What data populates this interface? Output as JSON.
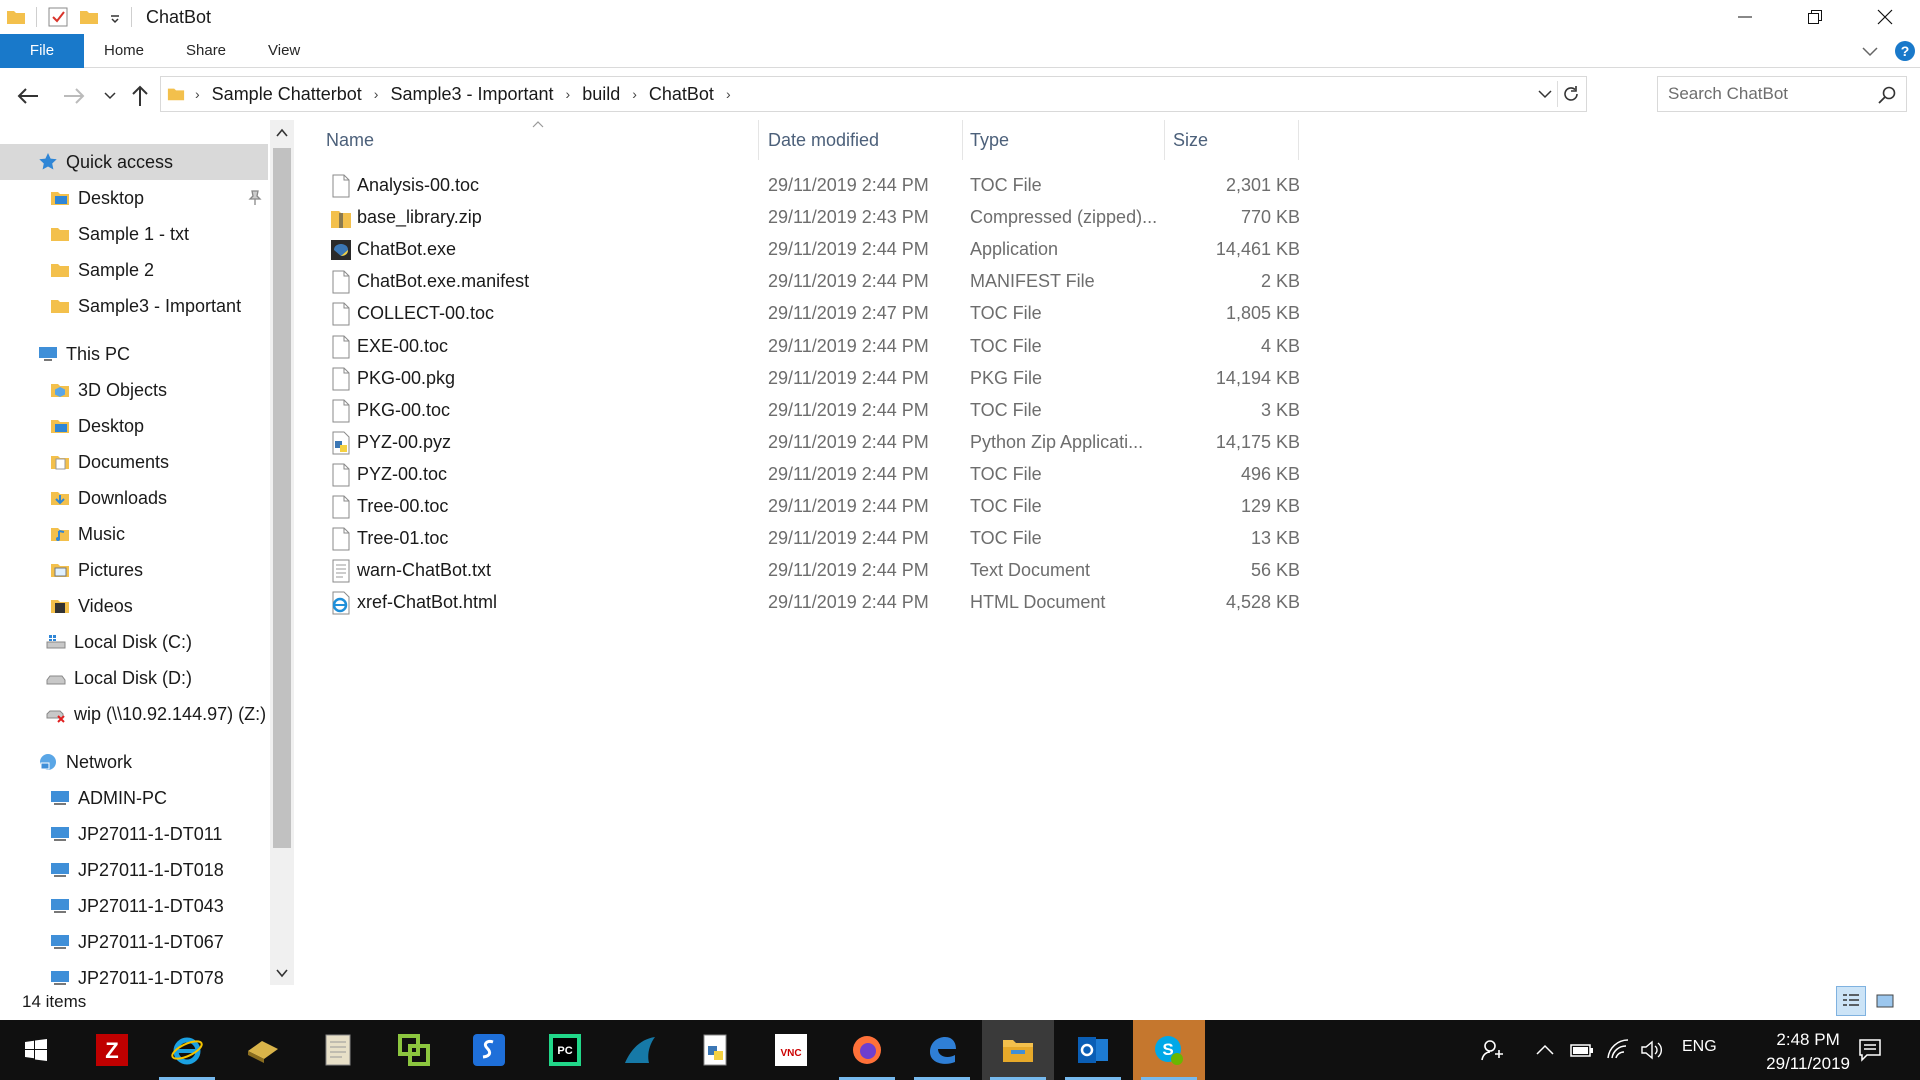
{
  "window": {
    "title": "ChatBot",
    "ribbon_tabs": [
      "File",
      "Home",
      "Share",
      "View"
    ]
  },
  "address": {
    "breadcrumbs": [
      "Sample Chatterbot",
      "Sample3 - Important",
      "build",
      "ChatBot"
    ]
  },
  "search": {
    "placeholder": "Search ChatBot"
  },
  "sidebar": {
    "quick_access": "Quick access",
    "quick_items": [
      "Desktop",
      "Sample 1 - txt",
      "Sample 2",
      "Sample3 - Important"
    ],
    "this_pc": "This PC",
    "pc_items": [
      "3D Objects",
      "Desktop",
      "Documents",
      "Downloads",
      "Music",
      "Pictures",
      "Videos",
      "Local Disk (C:)",
      "Local Disk (D:)",
      "wip (\\\\10.92.144.97) (Z:)"
    ],
    "network": "Network",
    "network_items": [
      "ADMIN-PC",
      "JP27011-1-DT011",
      "JP27011-1-DT018",
      "JP27011-1-DT043",
      "JP27011-1-DT067",
      "JP27011-1-DT078"
    ]
  },
  "columns": {
    "name": "Name",
    "date": "Date modified",
    "type": "Type",
    "size": "Size"
  },
  "files": [
    {
      "name": "Analysis-00.toc",
      "date": "29/11/2019 2:44 PM",
      "type": "TOC File",
      "size": "2,301 KB",
      "icon": "file-icon"
    },
    {
      "name": "base_library.zip",
      "date": "29/11/2019 2:43 PM",
      "type": "Compressed (zipped)...",
      "size": "770 KB",
      "icon": "zip-icon"
    },
    {
      "name": "ChatBot.exe",
      "date": "29/11/2019 2:44 PM",
      "type": "Application",
      "size": "14,461 KB",
      "icon": "exe-icon"
    },
    {
      "name": "ChatBot.exe.manifest",
      "date": "29/11/2019 2:44 PM",
      "type": "MANIFEST File",
      "size": "2 KB",
      "icon": "file-icon"
    },
    {
      "name": "COLLECT-00.toc",
      "date": "29/11/2019 2:47 PM",
      "type": "TOC File",
      "size": "1,805 KB",
      "icon": "file-icon"
    },
    {
      "name": "EXE-00.toc",
      "date": "29/11/2019 2:44 PM",
      "type": "TOC File",
      "size": "4 KB",
      "icon": "file-icon"
    },
    {
      "name": "PKG-00.pkg",
      "date": "29/11/2019 2:44 PM",
      "type": "PKG File",
      "size": "14,194 KB",
      "icon": "file-icon"
    },
    {
      "name": "PKG-00.toc",
      "date": "29/11/2019 2:44 PM",
      "type": "TOC File",
      "size": "3 KB",
      "icon": "file-icon"
    },
    {
      "name": "PYZ-00.pyz",
      "date": "29/11/2019 2:44 PM",
      "type": "Python Zip Applicati...",
      "size": "14,175 KB",
      "icon": "python-icon"
    },
    {
      "name": "PYZ-00.toc",
      "date": "29/11/2019 2:44 PM",
      "type": "TOC File",
      "size": "496 KB",
      "icon": "file-icon"
    },
    {
      "name": "Tree-00.toc",
      "date": "29/11/2019 2:44 PM",
      "type": "TOC File",
      "size": "129 KB",
      "icon": "file-icon"
    },
    {
      "name": "Tree-01.toc",
      "date": "29/11/2019 2:44 PM",
      "type": "TOC File",
      "size": "13 KB",
      "icon": "file-icon"
    },
    {
      "name": "warn-ChatBot.txt",
      "date": "29/11/2019 2:44 PM",
      "type": "Text Document",
      "size": "56 KB",
      "icon": "text-icon"
    },
    {
      "name": "xref-ChatBot.html",
      "date": "29/11/2019 2:44 PM",
      "type": "HTML Document",
      "size": "4,528 KB",
      "icon": "html-icon"
    }
  ],
  "status": {
    "items": "14 items"
  },
  "taskbar": {
    "apps": [
      "start-icon",
      "filezilla-icon",
      "internet-explorer-icon",
      "notes-icon",
      "document-icon",
      "vmware-icon",
      "sourcetree-icon",
      "pycharm-icon",
      "wireshark-icon",
      "python-file-icon",
      "vnc-icon",
      "firefox-icon",
      "edge-icon",
      "file-explorer-icon",
      "outlook-icon",
      "skype-icon"
    ],
    "language": "ENG",
    "time": "2:48 PM",
    "date": "29/11/2019"
  },
  "colors": {
    "accent": "#1979ca",
    "folder": "#f3c04c",
    "header_text": "#4c607a"
  }
}
